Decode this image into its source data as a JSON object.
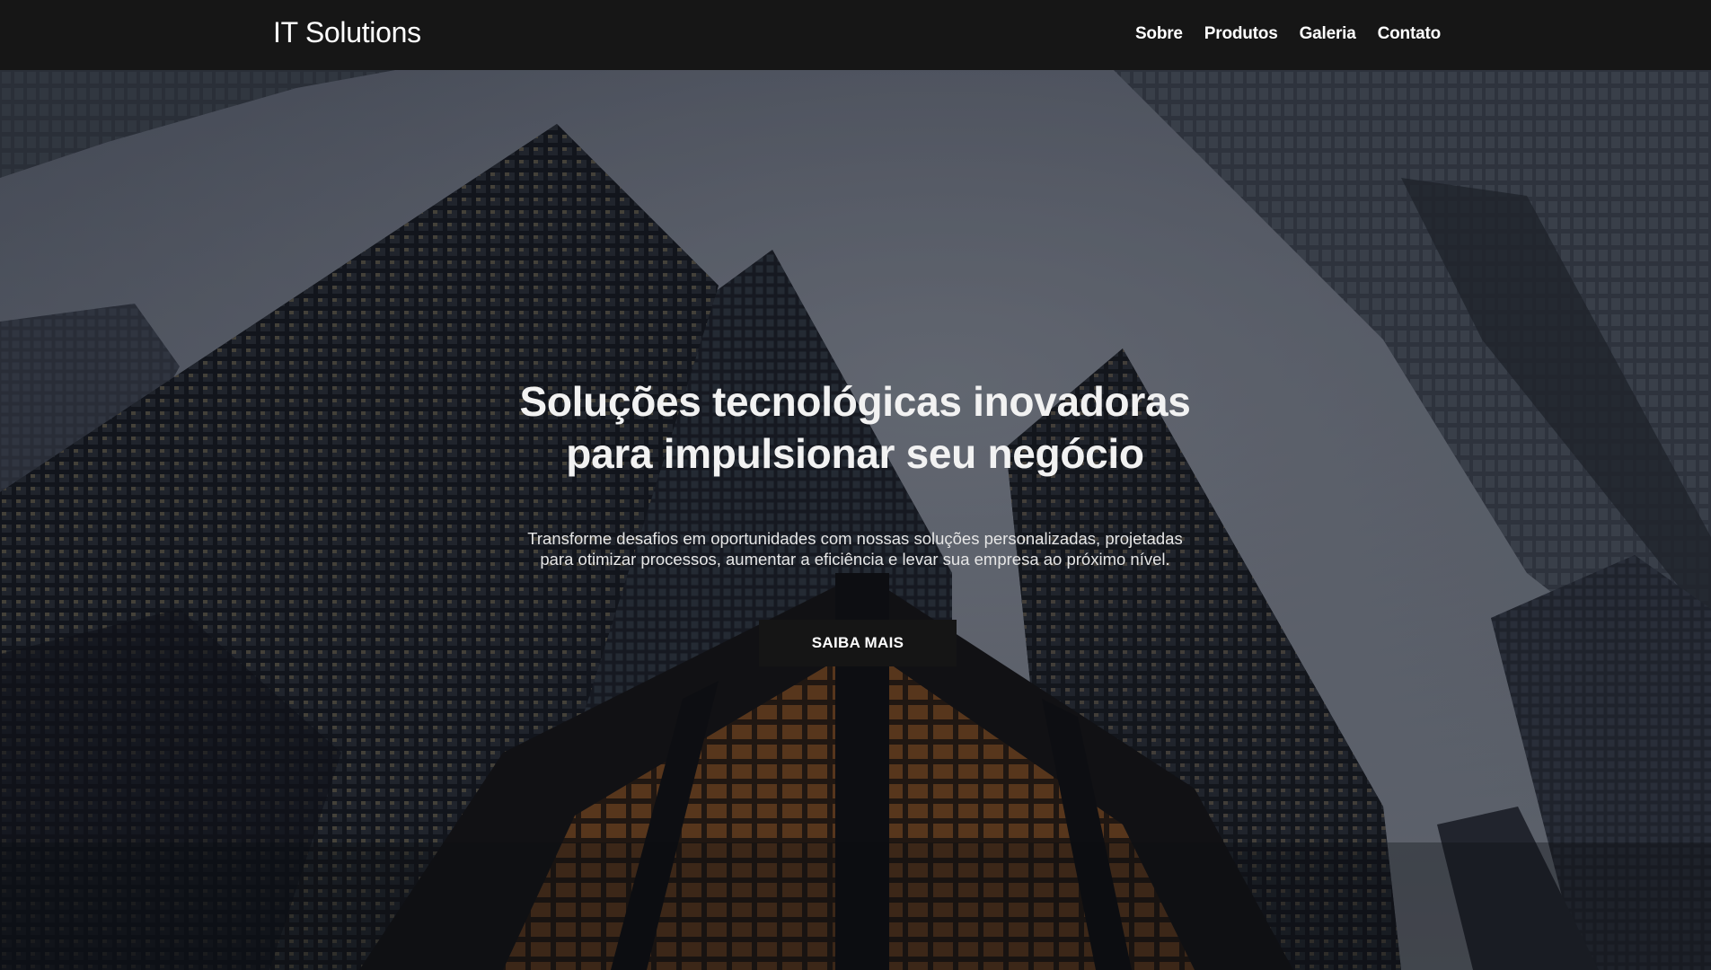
{
  "navbar": {
    "brand": "IT Solutions",
    "links": [
      {
        "label": "Sobre"
      },
      {
        "label": "Produtos"
      },
      {
        "label": "Galeria"
      },
      {
        "label": "Contato"
      }
    ]
  },
  "hero": {
    "title_line1": "Soluções tecnológicas inovadoras",
    "title_line2": "para impulsionar seu negócio",
    "subtitle_line1": "Transforme desafios em oportunidades com nossas soluções personalizadas, projetadas",
    "subtitle_line2": "para otimizar processos, aumentar a eficiência e levar sua empresa ao próximo nível.",
    "button_label": "SAIBA MAIS",
    "background_image": "city-skyscrapers-photo"
  },
  "colors": {
    "navbar_bg": "#161616",
    "button_bg": "#151515",
    "text": "#ffffff"
  }
}
